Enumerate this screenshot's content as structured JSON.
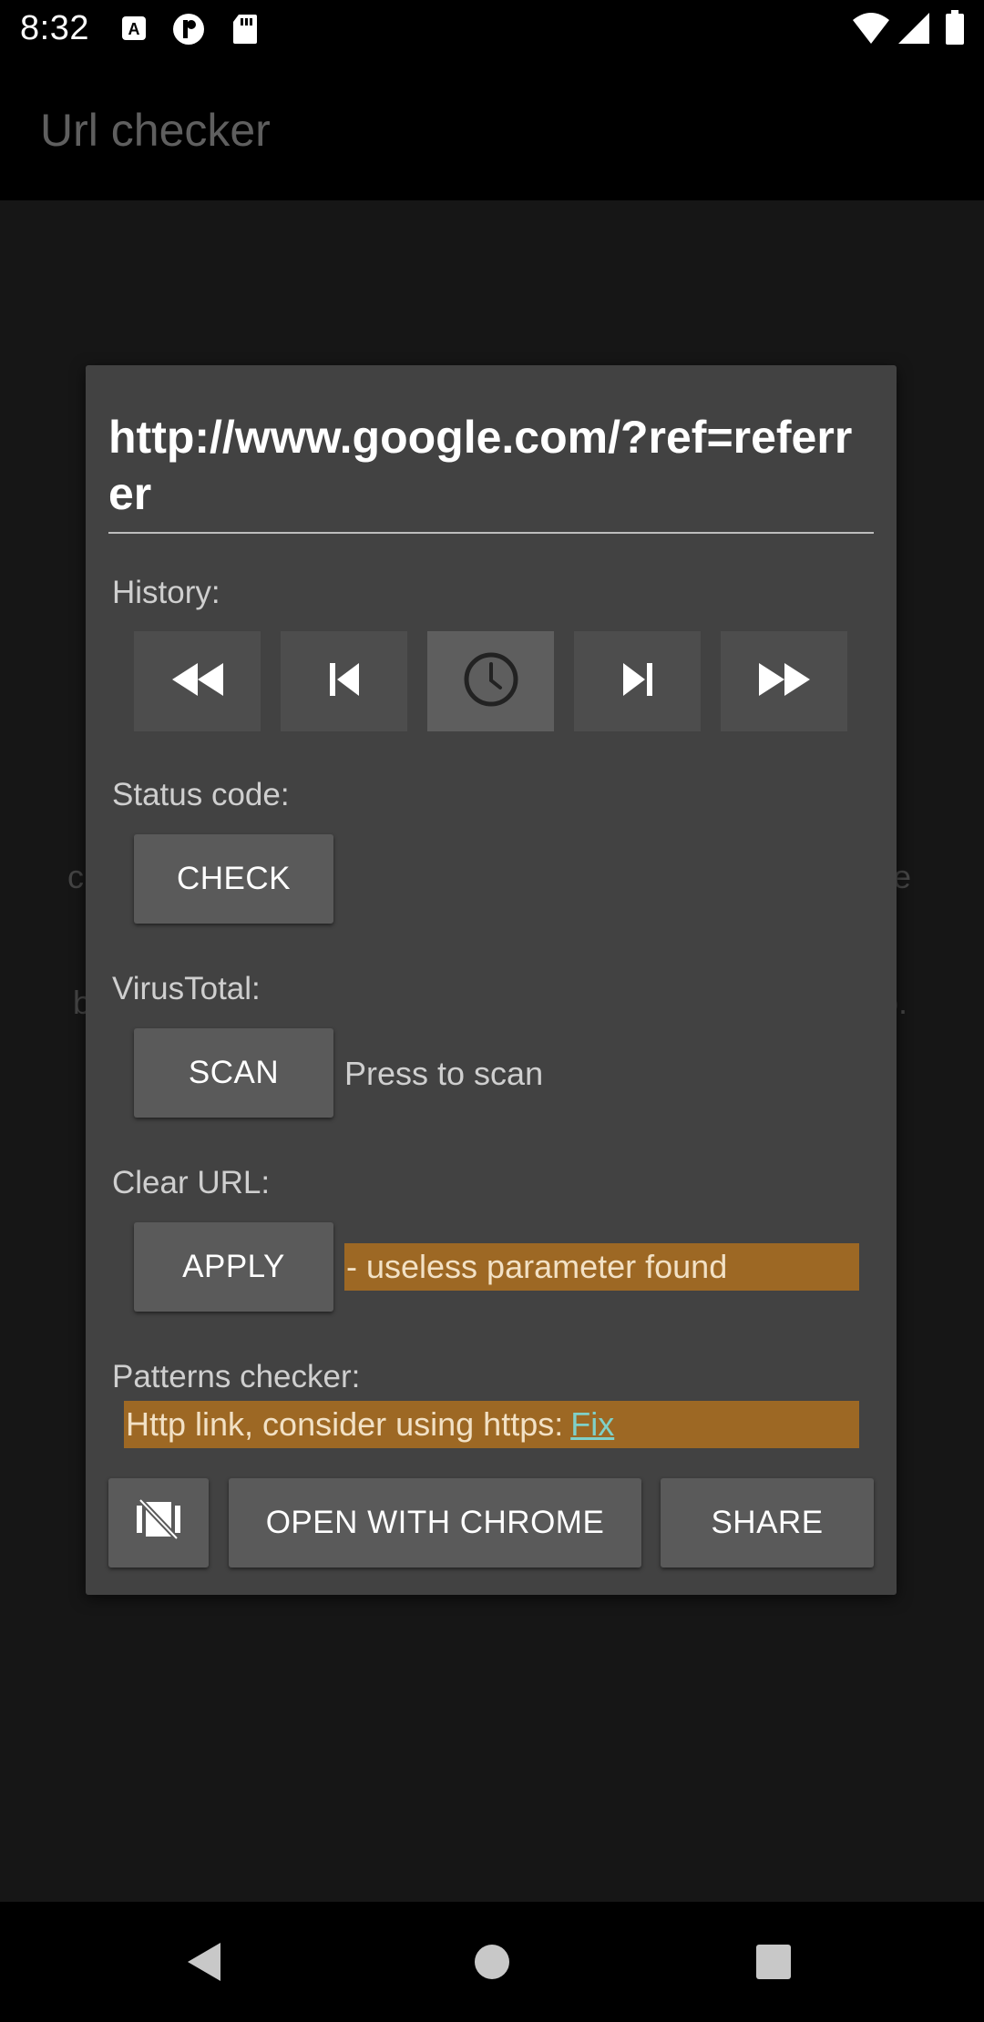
{
  "status_bar": {
    "time": "8:32",
    "icons": [
      "a-notification-icon",
      "p-notification-icon",
      "sd-card-icon",
      "wifi-icon",
      "signal-icon",
      "battery-icon"
    ]
  },
  "app_bar": {
    "title": "Url checker"
  },
  "background_fragments": {
    "left_1": "c",
    "right_1": "e",
    "left_2": "b",
    "right_2": "o."
  },
  "dialog": {
    "url": "http://www.google.com/?ref=referrer",
    "history": {
      "label": "History:",
      "buttons": [
        "rewind-icon",
        "skip-previous-icon",
        "history-clock-icon",
        "skip-next-icon",
        "fast-forward-icon"
      ]
    },
    "status_code": {
      "label": "Status code:",
      "button": "CHECK"
    },
    "virustotal": {
      "label": "VirusTotal:",
      "button": "SCAN",
      "result": "Press to scan"
    },
    "clear_url": {
      "label": "Clear URL:",
      "button": "APPLY",
      "result": "- useless parameter found",
      "result_color": "#9d6824"
    },
    "patterns": {
      "label": "Patterns checker:",
      "message": "Http link, consider using https:",
      "fix_link": "Fix",
      "message_color": "#9d6824"
    },
    "actions": {
      "ctabs_icon": "ctabs-off-icon",
      "open_with": "OPEN WITH CHROME",
      "share": "SHARE"
    }
  },
  "nav_bar": {
    "icons": [
      "back-icon",
      "home-icon",
      "recents-icon"
    ]
  }
}
